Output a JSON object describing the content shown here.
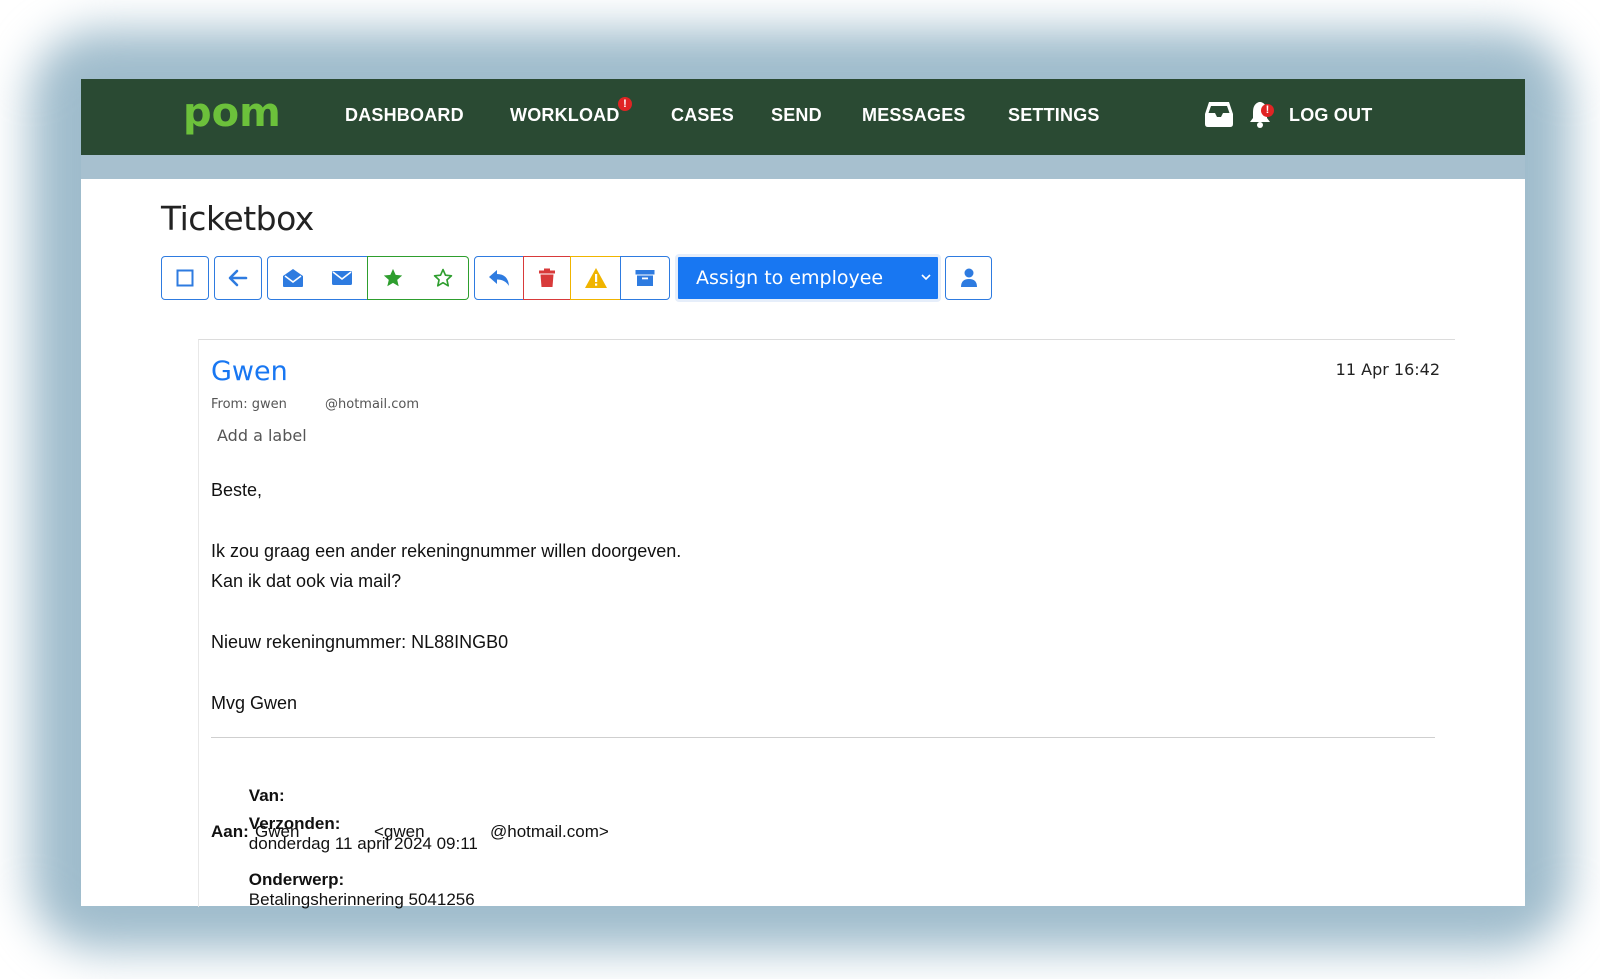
{
  "nav": {
    "logo_text": "pom",
    "items": [
      {
        "label": "DASHBOARD"
      },
      {
        "label": "WORKLOAD",
        "badge": "!"
      },
      {
        "label": "CASES"
      },
      {
        "label": "SEND"
      },
      {
        "label": "MESSAGES"
      },
      {
        "label": "SETTINGS"
      }
    ],
    "notification_badge": "!",
    "logout_label": "LOG OUT"
  },
  "page": {
    "title": "Ticketbox"
  },
  "toolbar": {
    "buttons": [
      {
        "icon": "checkbox-icon"
      },
      {
        "icon": "arrow-left-icon"
      },
      {
        "icon": "envelope-open-icon"
      },
      {
        "icon": "envelope-icon"
      },
      {
        "icon": "star-filled-icon"
      },
      {
        "icon": "star-outline-icon"
      },
      {
        "icon": "reply-icon"
      },
      {
        "icon": "trash-icon"
      },
      {
        "icon": "warning-icon"
      },
      {
        "icon": "archive-icon"
      },
      {
        "icon": "user-icon"
      }
    ],
    "assign_selected": "Assign to employee"
  },
  "message": {
    "sender": "Gwen",
    "date": "11 Apr 16:42",
    "from_prefix": "From: gwen",
    "from_domain": "@hotmail.com",
    "add_label": "Add a label",
    "body": {
      "greeting": "Beste,",
      "line1": "Ik zou graag een ander rekeningnummer willen doorgeven.",
      "line2": "Kan ik dat ook via mail?",
      "line3": "Nieuw rekeningnummer: NL88INGB0",
      "signoff": "Mvg Gwen"
    },
    "quoted": {
      "van_label": "Van:",
      "verzonden_label": "Verzonden:",
      "verzonden_value": "donderdag 11 april 2024 09:11",
      "aan_label": "Aan:",
      "aan_name": "Gwen",
      "aan_email_start": "<gwen",
      "aan_email_end": "@hotmail.com>",
      "onderwerp_label": "Onderwerp:",
      "onderwerp_value": "Betalingsherinnering 5041256"
    }
  },
  "colors": {
    "navbar": "#2a4a33",
    "logo": "#6cc13b",
    "accent": "#1877f2",
    "badge": "#e02424"
  }
}
